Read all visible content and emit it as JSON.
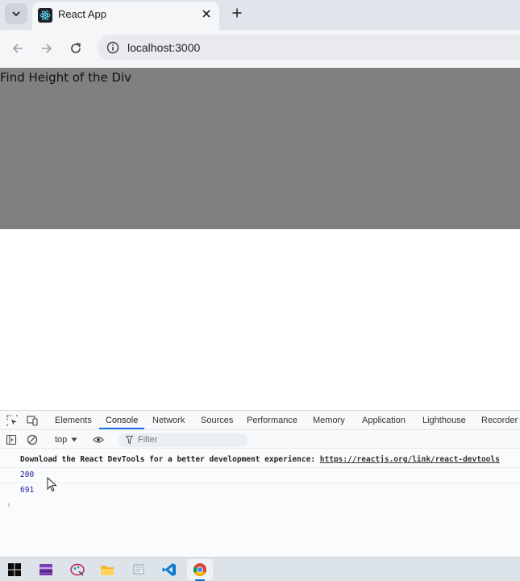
{
  "browser": {
    "tab_title": "React App",
    "url": "localhost:3000"
  },
  "page": {
    "div_text": "Find Height of the Div",
    "div_color": "#808080"
  },
  "devtools": {
    "tabs": [
      "Elements",
      "Console",
      "Network",
      "Sources",
      "Performance",
      "Memory",
      "Application",
      "Lighthouse",
      "Recorder"
    ],
    "active_tab": "Console",
    "context": "top",
    "filter_placeholder": "Filter",
    "logs": {
      "message": "Download the React DevTools for a better development experience: ",
      "link": "https://reactjs.org/link/react-devtools",
      "values": [
        "200",
        "691"
      ]
    },
    "prompt_symbol": "›"
  },
  "taskbar": {
    "items": [
      "windows-start",
      "winrar",
      "paint",
      "file-explorer",
      "notepad",
      "vscode",
      "chrome"
    ],
    "active_item": "chrome"
  },
  "colors": {
    "accent": "#1a73e8",
    "log_number": "#1a1aa6"
  }
}
